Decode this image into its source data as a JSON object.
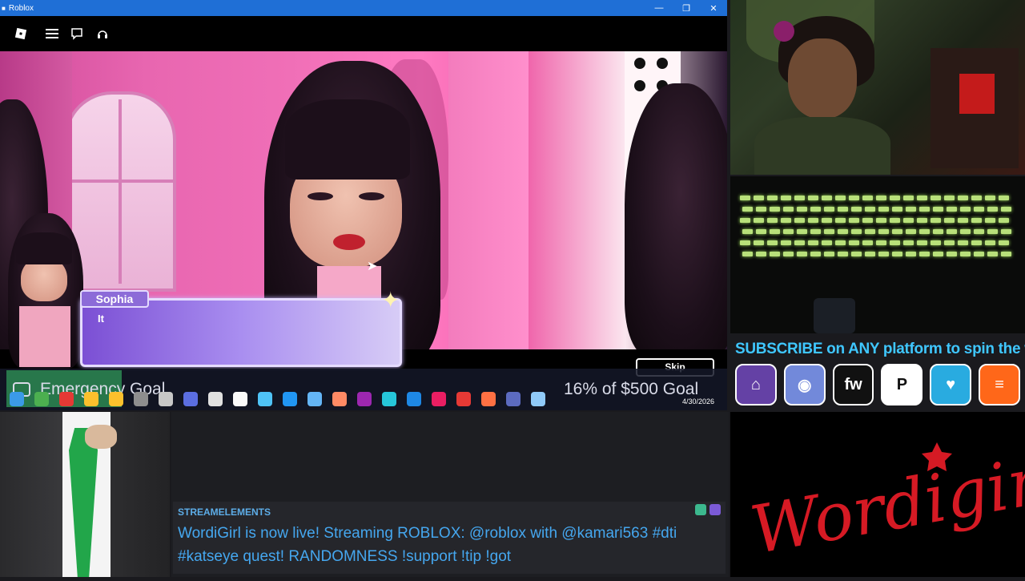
{
  "window": {
    "title": "Roblox",
    "controls": {
      "minimize": "—",
      "maximize": "❐",
      "close": "✕"
    }
  },
  "toolbar": {
    "icons": [
      "roblox-logo-icon",
      "menu-icon",
      "chat-icon",
      "headset-icon"
    ]
  },
  "game": {
    "speaker": "Sophia",
    "dialog_text": "It",
    "skip_label": "Skip"
  },
  "goal": {
    "title": "Emergency Goal",
    "amount": "16% of $500 Goal",
    "progress_percent": 16
  },
  "taskbar": {
    "date": "4/30/2026",
    "app_icons": [
      "start-icon",
      "search-icon",
      "chrome-icon",
      "explorer-icon",
      "folder-icon",
      "store-icon",
      "app-icon",
      "app-icon",
      "media-icon",
      "gmail-icon",
      "app-icon",
      "app-icon",
      "photos-icon",
      "app-icon",
      "app-icon",
      "app-icon",
      "app-icon",
      "app-icon",
      "wps-icon",
      "record-icon",
      "app-icon",
      "app-icon",
      "roblox-icon"
    ],
    "colors": [
      "#3b9ae8",
      "#4caf50",
      "#e53935",
      "#fbc02d",
      "#fbc02d",
      "#8e8e8e",
      "#c7c7c7",
      "#5b6ee1",
      "#e0e0e0",
      "#fafafa",
      "#4fc3f7",
      "#2196f3",
      "#64b5f6",
      "#ff8a65",
      "#9c27b0",
      "#26c6da",
      "#1e88e5",
      "#e91e63",
      "#e53935",
      "#ff7043",
      "#5c6bc0",
      "#90caf9"
    ]
  },
  "subscribe": {
    "text": "SUBSCRIBE on ANY platform to spin the wheel!",
    "platforms": [
      {
        "name": "twitch",
        "glyph": "⌂",
        "bg": "#6441a5",
        "fg": "#ffffff"
      },
      {
        "name": "discord",
        "glyph": "◉",
        "bg": "#7289da",
        "fg": "#ffffff"
      },
      {
        "name": "fourthwall",
        "glyph": "fw",
        "bg": "#111111",
        "fg": "#ffffff"
      },
      {
        "name": "patreon",
        "glyph": "P",
        "bg": "#ffffff",
        "fg": "#111111"
      },
      {
        "name": "kofi",
        "glyph": "♥",
        "bg": "#29abe0",
        "fg": "#ffffff"
      },
      {
        "name": "substack",
        "glyph": "≡",
        "bg": "#ff6719",
        "fg": "#ffffff"
      }
    ]
  },
  "chat": {
    "source": "STREAMELEMENTS",
    "message": "WordiGirl is now live! Streaming ROBLOX: @roblox with @kamari563 #dti #katseye quest! RANDOMNESS !support !tip !got"
  },
  "logo": {
    "text": "Wordigirl",
    "color": "#d61a24"
  }
}
